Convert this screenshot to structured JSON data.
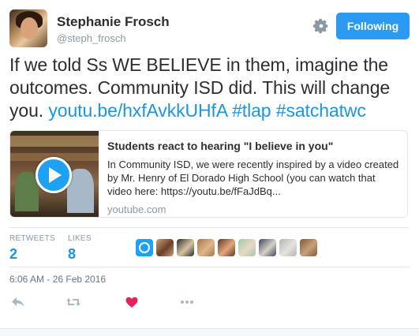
{
  "user": {
    "name": "Stephanie Frosch",
    "handle": "@steph_frosch"
  },
  "follow_button": {
    "label": "Following",
    "color": "#2b9af3"
  },
  "tweet": {
    "text_plain": "If we told Ss WE BELIEVE in them, imagine the outcomes. Community ISD did. This will change you.",
    "link": "youtu.be/hxfAvkkUHfA",
    "hashtag1": "#tlap",
    "hashtag2": "#satchatwc",
    "link_color": "#1b95e0"
  },
  "card": {
    "title": "Students react to hearing \"I believe in you\"",
    "description": "In Community ISD, we were recently inspired by a video created by Mr. Henry of El Dorado High School (you can watch that video here: https://youtu.be/fFaJdBq...",
    "domain": "youtube.com",
    "thumbnail_icon": "play-icon"
  },
  "stats": {
    "retweets_label": "RETWEETS",
    "retweets_value": "2",
    "likes_label": "LIKES",
    "likes_value": "8"
  },
  "likers": [
    {
      "name": "default-avatar",
      "colors": [
        "#1da1f2"
      ]
    },
    {
      "name": "liker-2",
      "colors": [
        "#c9a27a",
        "#6b3e2a"
      ]
    },
    {
      "name": "liker-3",
      "colors": [
        "#2c2c2c",
        "#d8c3a0"
      ]
    },
    {
      "name": "liker-4",
      "colors": [
        "#a07848",
        "#e0b68a"
      ]
    },
    {
      "name": "liker-5",
      "colors": [
        "#5a3a28",
        "#e4a67a"
      ]
    },
    {
      "name": "liker-6",
      "colors": [
        "#9ec9b0",
        "#e9d7c4"
      ]
    },
    {
      "name": "liker-7",
      "colors": [
        "#3b4a5a",
        "#d8d0c8"
      ]
    },
    {
      "name": "liker-8",
      "colors": [
        "#b0b6bc",
        "#e6e2dd"
      ]
    },
    {
      "name": "liker-9",
      "colors": [
        "#7c5a3a",
        "#c8a07a"
      ]
    }
  ],
  "timestamp": "6:06 AM - 26 Feb 2016",
  "actions": {
    "reply_icon": "reply-icon",
    "retweet_icon": "retweet-icon",
    "like_icon": "heart-icon",
    "more_icon": "more-icon",
    "like_color": "#e0245e",
    "muted_color": "#aab8c2"
  }
}
